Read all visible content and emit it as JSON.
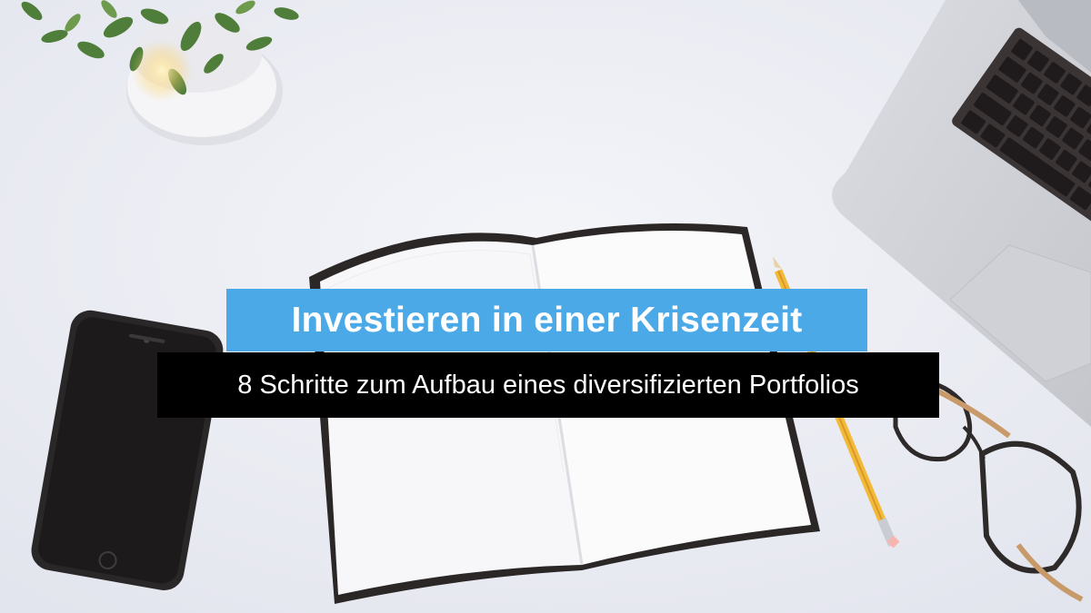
{
  "title": "Investieren in einer Krisenzeit",
  "subtitle": "8 Schritte zum Aufbau eines diversifizierten Portfolios",
  "scene_objects": [
    "plant-pot",
    "laptop",
    "smartphone",
    "open-notebook",
    "pencil",
    "eyeglasses"
  ],
  "colors": {
    "desk": "#eceef4",
    "title_banner": "#4aa9e6",
    "subtitle_banner": "#000000",
    "banner_text": "#ffffff",
    "pencil": "#f2b93a",
    "plant_leaf": "#4f7d3a"
  }
}
